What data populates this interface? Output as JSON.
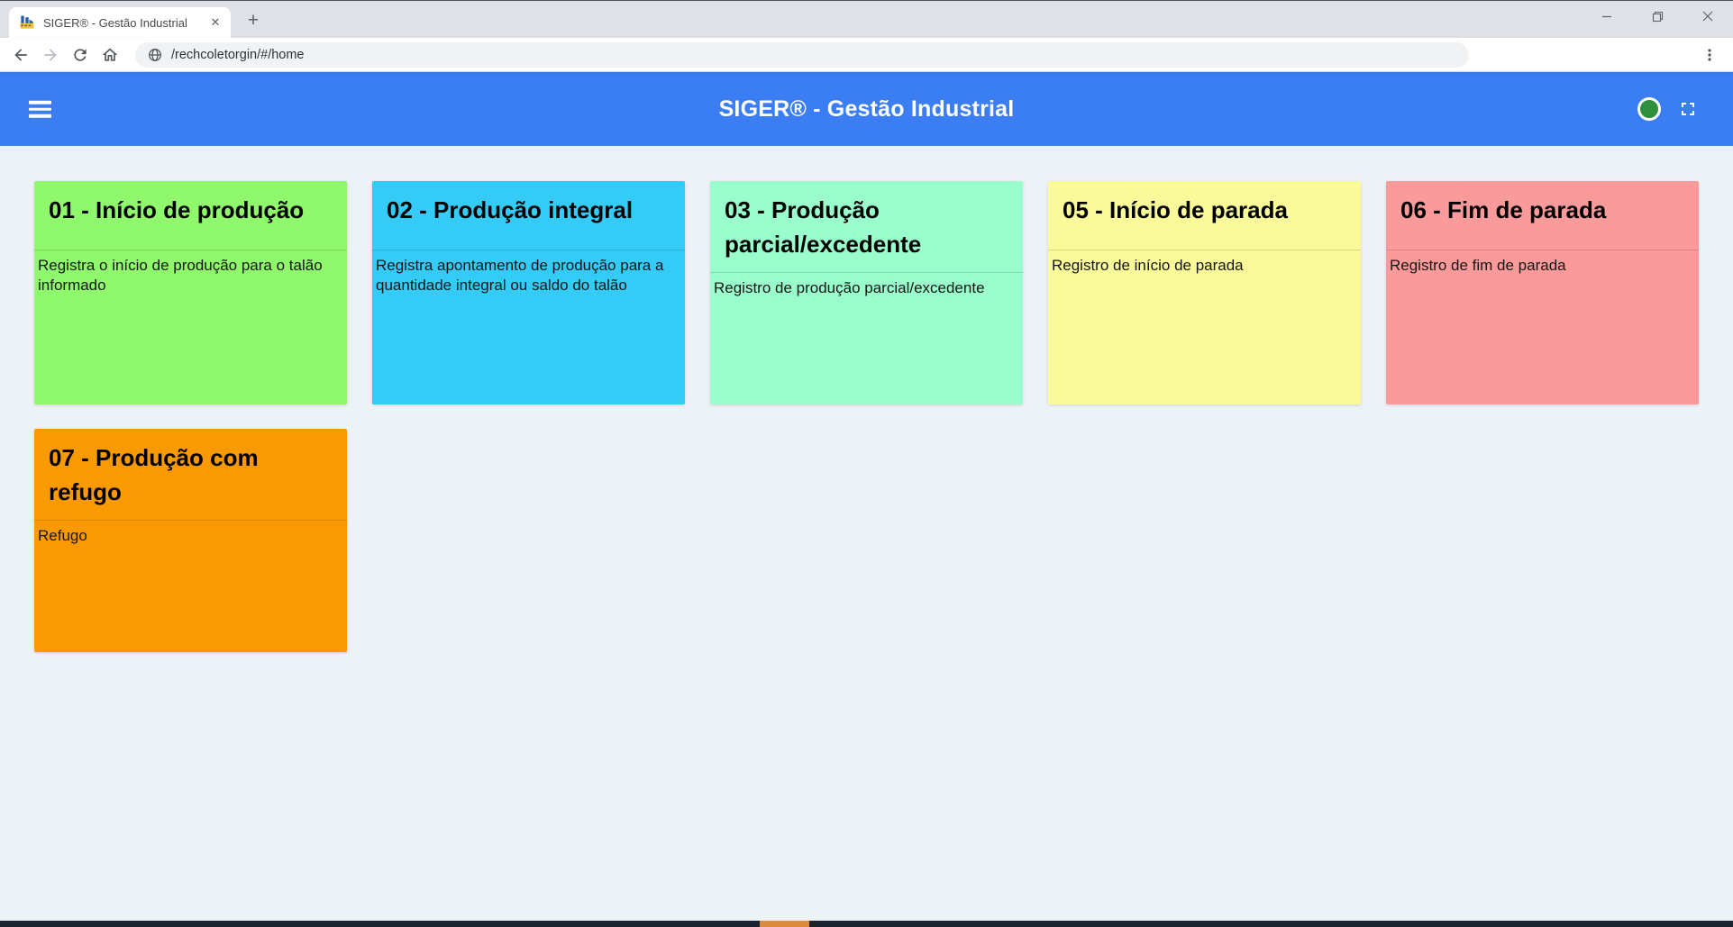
{
  "browser": {
    "tab_title": "SIGER® - Gestão Industrial",
    "close_glyph": "✕",
    "new_tab_glyph": "+",
    "url": "/rechcoletorgin/#/home"
  },
  "header": {
    "title": "SIGER® - Gestão Industrial"
  },
  "colors": {
    "header_bar": "#3B7DF2",
    "status_indicator": "#2E8F3D",
    "page_background": "#EDF2F7",
    "taskbar": "#1B2431",
    "taskbar_accent": "#DD8B3D"
  },
  "cards": [
    {
      "title": "01 - Início de produção",
      "description": "Registra o início de produção para o talão informado",
      "color": "#8FF86D"
    },
    {
      "title": "02 - Produção integral",
      "description": "Registra apontamento de produção para a quantidade integral ou saldo do talão",
      "color": "#34CCF7"
    },
    {
      "title": "03 - Produção parcial/excedente",
      "description": "Registro de produção parcial/excedente",
      "color": "#9AFECC"
    },
    {
      "title": "05 - Início de parada",
      "description": "Registro de início de parada",
      "color": "#FAFA9A"
    },
    {
      "title": "06 - Fim de parada",
      "description": "Registro de fim de parada",
      "color": "#FB9A9A"
    },
    {
      "title": "07 - Produção com refugo",
      "description": "Refugo",
      "color": "#FA9A02"
    }
  ]
}
